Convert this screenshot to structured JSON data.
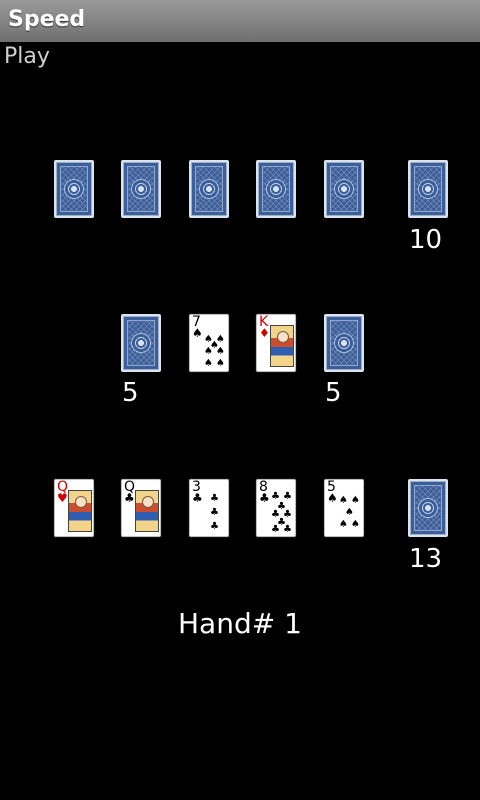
{
  "app": {
    "title": "Speed"
  },
  "menu": {
    "play_label": "Play"
  },
  "opponent": {
    "hand": [
      "card-back",
      "card-back",
      "card-back",
      "card-back",
      "card-back"
    ],
    "draw_pile_count": "10"
  },
  "middle": {
    "left_pile_count": "5",
    "right_pile_count": "5",
    "play_piles": [
      {
        "rank": "7",
        "suit": "♠",
        "color": "black"
      },
      {
        "rank": "K",
        "suit": "♦",
        "color": "red"
      }
    ]
  },
  "player": {
    "hand": [
      {
        "rank": "Q",
        "suit": "♥",
        "color": "red"
      },
      {
        "rank": "Q",
        "suit": "♣",
        "color": "black"
      },
      {
        "rank": "3",
        "suit": "♣",
        "color": "black"
      },
      {
        "rank": "8",
        "suit": "♣",
        "color": "black"
      },
      {
        "rank": "5",
        "suit": "♠",
        "color": "black"
      }
    ],
    "draw_pile_count": "13"
  },
  "status": {
    "hand_label": "Hand# 1"
  },
  "colors": {
    "card_back": "#3d5f99",
    "background": "#000000"
  }
}
